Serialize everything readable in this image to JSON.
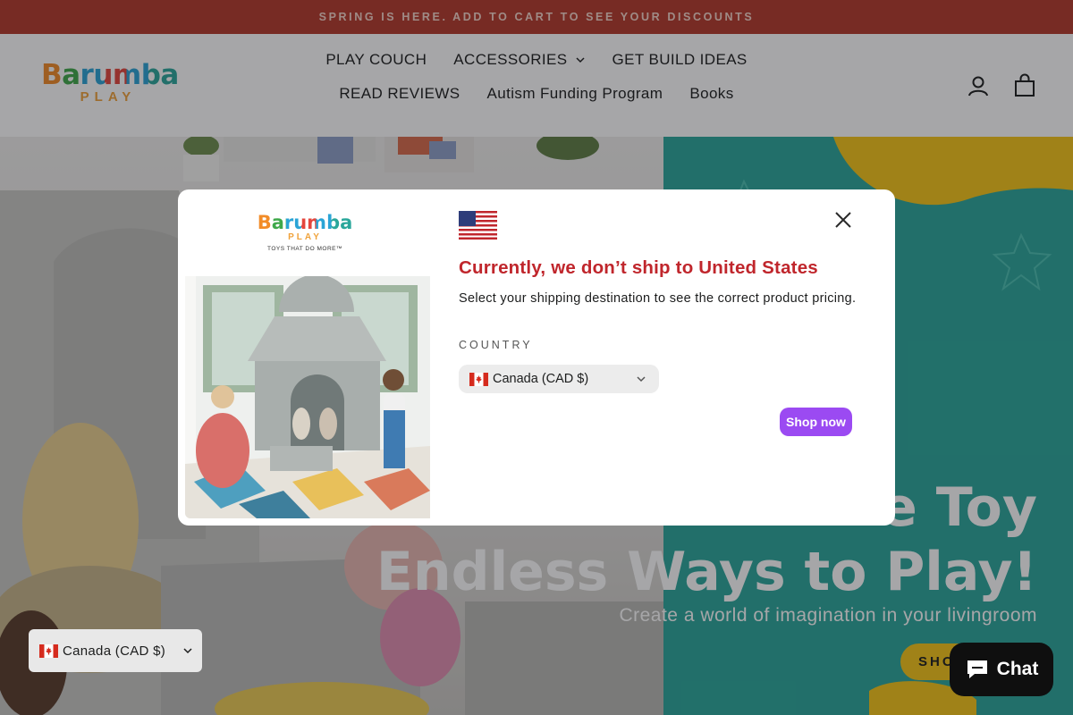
{
  "announcement": {
    "text": "SPRING IS HERE. ADD TO CART TO SEE YOUR DISCOUNTS"
  },
  "header": {
    "logo": {
      "word": "Barumba",
      "sub": "PLAY"
    },
    "nav": [
      {
        "label": "PLAY COUCH"
      },
      {
        "label": "ACCESSORIES",
        "has_dropdown": true
      },
      {
        "label": "GET BUILD IDEAS"
      },
      {
        "label": "READ REVIEWS"
      },
      {
        "label": "Autism Funding Program"
      },
      {
        "label": "Books"
      }
    ],
    "icons": {
      "account": "account-icon",
      "cart": "cart-icon"
    }
  },
  "hero": {
    "headline_line1": "ne Toy",
    "headline_line2": "Endless Ways to Play!",
    "subtitle": "Create a world of imagination in your livingroom",
    "button_label": "SHO"
  },
  "floating_country": {
    "label": "Canada (CAD $)"
  },
  "chat": {
    "label": "Chat"
  },
  "modal": {
    "logo": {
      "word": "Barumba",
      "sub": "PLAY",
      "tagline": "TOYS THAT DO MORE™"
    },
    "title": "Currently, we don’t ship to United States",
    "description": "Select your shipping destination to see the correct product pricing.",
    "country_label": "COUNTRY",
    "selected_country": "Canada (CAD $)",
    "shop_button": "Shop now"
  },
  "colors": {
    "announcement_bg": "#b4392a",
    "modal_title": "#c0262c",
    "shop_button": "#9b4af2",
    "hero_teal": "#2aa79b",
    "hero_button": "#f5c518",
    "chat_bg": "#0f0f0f"
  }
}
